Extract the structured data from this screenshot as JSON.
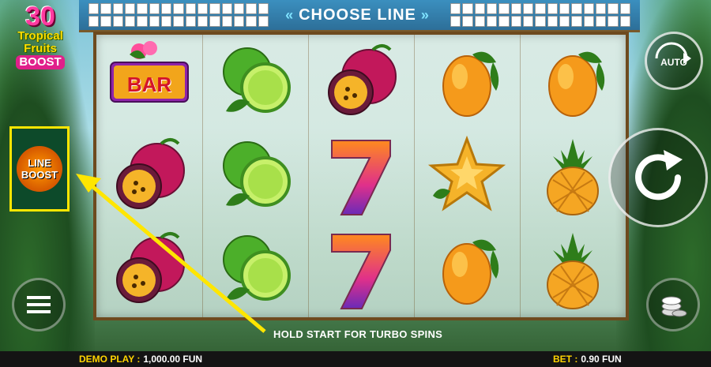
{
  "logo": {
    "number": "30",
    "line1": "Tropical",
    "line2": "Fruits",
    "line3": "BOOST"
  },
  "header": {
    "choose_line_label": "CHOOSE LINE"
  },
  "boost_button": {
    "line1": "LINE",
    "line2": "BOOST"
  },
  "auto_button": {
    "label": "AUTO"
  },
  "reels": [
    [
      "bar",
      "passion-fruit",
      "passion-fruit"
    ],
    [
      "lime",
      "lime",
      "lime"
    ],
    [
      "passion-fruit",
      "seven",
      "seven"
    ],
    [
      "mango",
      "star-fruit",
      "mango"
    ],
    [
      "mango",
      "pineapple",
      "pineapple"
    ]
  ],
  "bar_label": "BAR",
  "hint": "HOLD START FOR TURBO SPINS",
  "footer": {
    "demo_label": "DEMO PLAY :",
    "demo_value": "1,000.00 FUN",
    "bet_label": "BET :",
    "bet_value": "0.90 FUN"
  },
  "colors": {
    "highlight": "#ffe600",
    "accent_pink": "#ff3aa0",
    "frame": "#6e4a1e"
  },
  "icons": [
    "menu-icon",
    "auto-icon",
    "spin-icon",
    "coins-icon"
  ]
}
